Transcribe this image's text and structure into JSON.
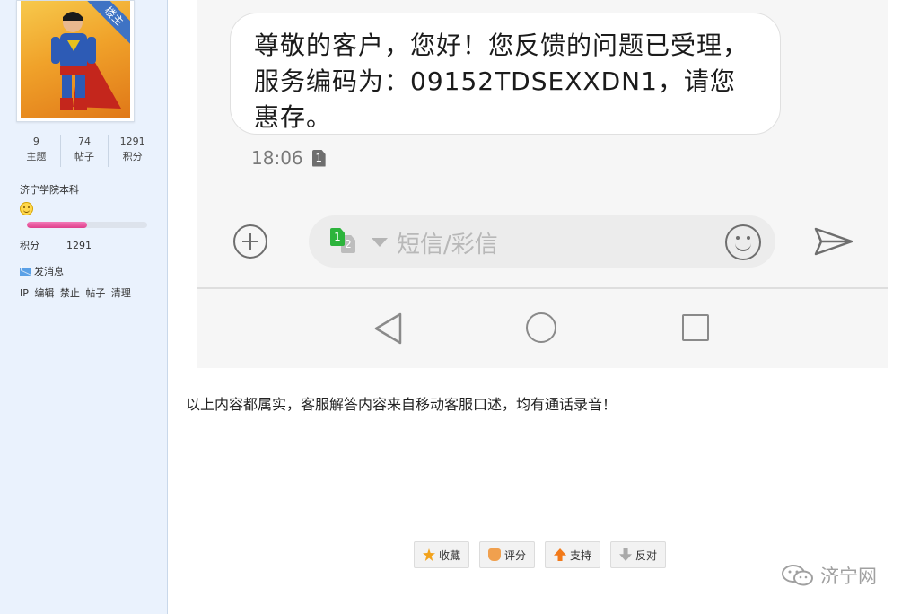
{
  "sidebar": {
    "owner_badge": "楼主",
    "stats": [
      {
        "value": "9",
        "label": "主题"
      },
      {
        "value": "74",
        "label": "帖子"
      },
      {
        "value": "1291",
        "label": "积分"
      }
    ],
    "user_group": "济宁学院本科",
    "level_progress": 0.5,
    "points_label": "积分",
    "points_value": "1291",
    "send_message": "发消息",
    "admin_links": [
      "IP",
      "编辑",
      "禁止",
      "帖子",
      "清理"
    ]
  },
  "sms": {
    "message": "尊敬的客户，您好！您反馈的问题已受理，服务编码为：09152TDSEXXDN1，请您惠存。",
    "time": "18:06",
    "sim_label": "1",
    "sim_green": "1",
    "sim_grey": "2",
    "input_placeholder": "短信/彩信"
  },
  "post": {
    "text": "以上内容都属实，客服解答内容来自移动客服口述，均有通话录音！"
  },
  "actions": {
    "favorite": "收藏",
    "rate": "评分",
    "support": "支持",
    "oppose": "反对"
  },
  "watermark": "济宁网",
  "colors": {
    "sidebar_bg": "#eaf2fd",
    "badge": "#3f73c4",
    "progress": "#e0408d",
    "sim_green": "#2db43c"
  }
}
